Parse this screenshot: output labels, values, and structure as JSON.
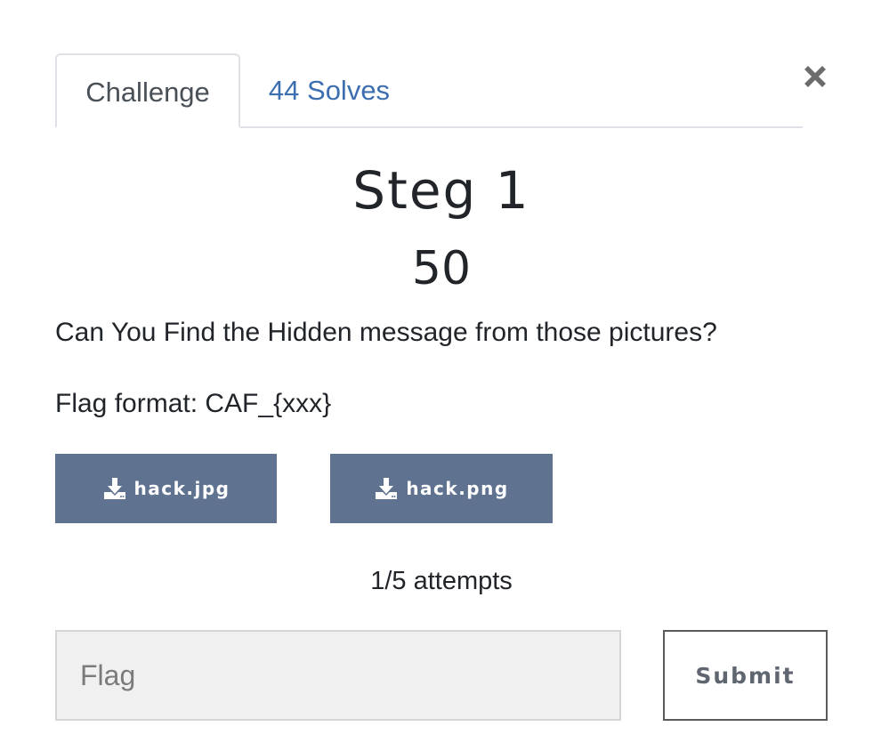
{
  "tabs": [
    {
      "label": "Challenge",
      "active": true
    },
    {
      "label": "44 Solves",
      "active": false
    }
  ],
  "close": {
    "icon": "close-icon",
    "glyph": "×"
  },
  "challenge": {
    "name": "Steg 1",
    "value": "50",
    "description": [
      "Can You Find the Hidden message from those pictures?",
      "Flag format: CAF_{xxx}"
    ]
  },
  "files": [
    {
      "label": "hack.jpg",
      "icon": "download-icon"
    },
    {
      "label": "hack.png",
      "icon": "download-icon"
    }
  ],
  "attempts": "1/5 attempts",
  "flag_input": {
    "value": "",
    "placeholder": "Flag"
  },
  "submit": {
    "label": "Submit"
  },
  "colors": {
    "file_button_bg": "#5f7290",
    "tab_link": "#3d6fb0",
    "input_bg": "#f0f0f0"
  }
}
